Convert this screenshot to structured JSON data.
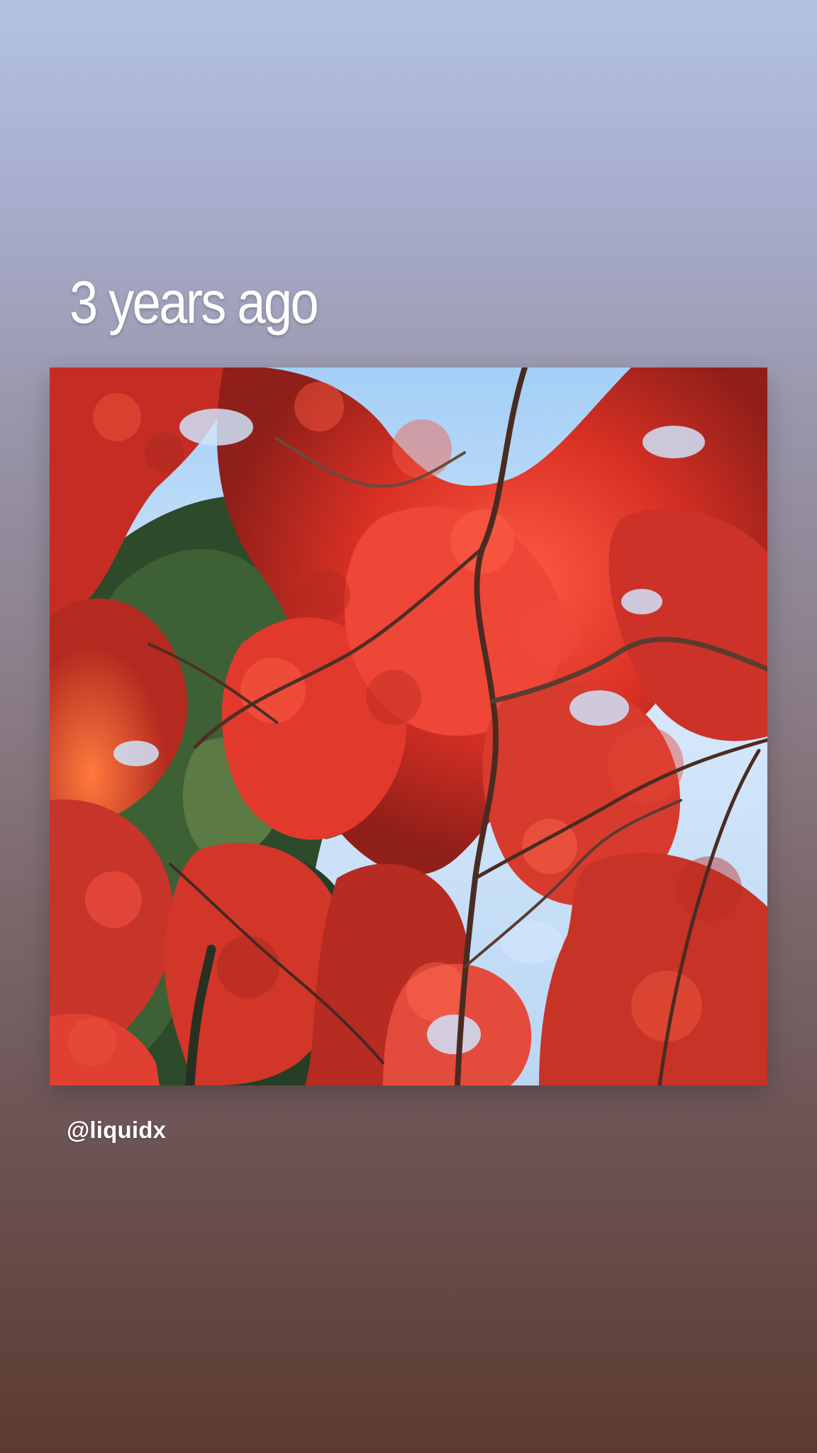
{
  "story": {
    "memory_label": "3 years ago",
    "username": "@liquidx"
  },
  "photo": {
    "subject": "red maple leaves",
    "accent_colors": {
      "sky": "#9cc6f0",
      "maple_red": "#e0382d",
      "pine_green": "#2f4d2b",
      "branch_brown": "#4a2b22"
    }
  }
}
